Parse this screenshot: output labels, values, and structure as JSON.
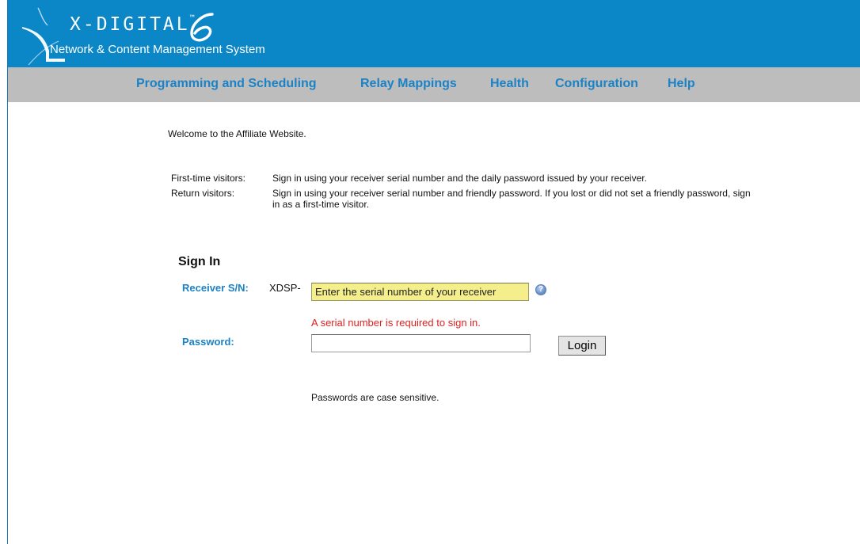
{
  "header": {
    "brand_name": "X-DIGITAL",
    "brand_mark": "™",
    "subtitle": "Network & Content Management System"
  },
  "nav": {
    "items": [
      {
        "label": "Programming and Scheduling"
      },
      {
        "label": "Relay Mappings"
      },
      {
        "label": "Health"
      },
      {
        "label": "Configuration"
      },
      {
        "label": "Help"
      }
    ]
  },
  "main": {
    "welcome": "Welcome to the Affiliate Website.",
    "visitors": [
      {
        "label": "First-time visitors:",
        "text": "Sign in using your receiver serial number and the daily password issued by your receiver."
      },
      {
        "label": "Return visitors:",
        "text": "Sign in using your receiver serial number and friendly password. If you lost or did not set a friendly password, sign in as a first-time visitor."
      }
    ],
    "signin": {
      "title": "Sign In",
      "receiver_label": "Receiver S/N:",
      "serial_prefix": "XDSP-",
      "serial_placeholder": "Enter the serial number of your receiver",
      "serial_value": "",
      "help_icon_glyph": "?",
      "error": "A serial number is required to sign in.",
      "password_label": "Password:",
      "password_value": "",
      "login_label": "Login",
      "case_note": "Passwords are case sensitive."
    }
  },
  "colors": {
    "header_bg": "#0b87c8",
    "nav_bg": "#bdbdbd",
    "link": "#1b82c5",
    "error": "#e02020",
    "serial_input_bg": "#f4ef8b"
  }
}
